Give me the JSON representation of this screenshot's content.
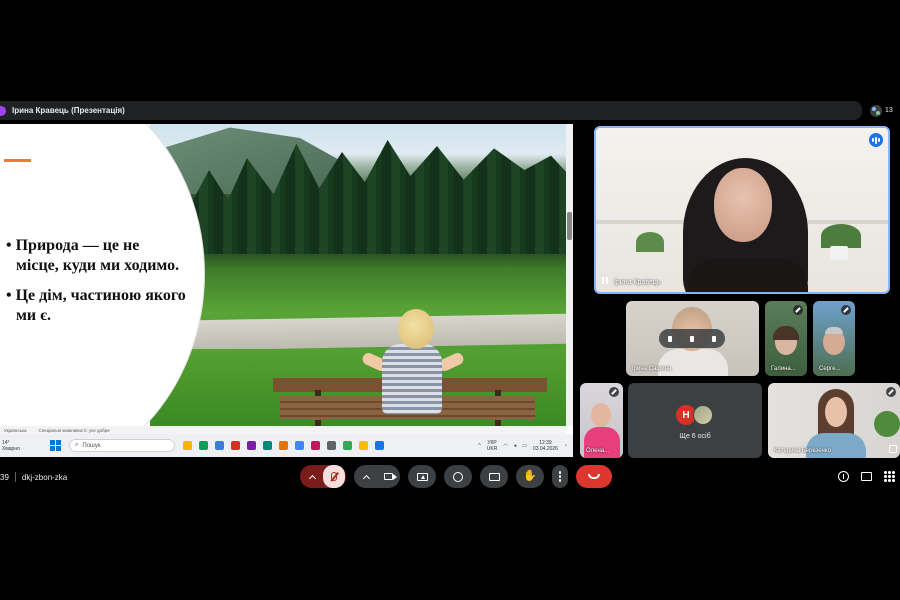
{
  "presentation": {
    "presenter_label": "Ірина Кравець (Презентація)",
    "participant_count": "13"
  },
  "slide": {
    "bullets": [
      "• Природа — це не місце, куди ми ходимо.",
      "• Це дім, частиною якого ми є."
    ]
  },
  "shared_screen": {
    "status_items": [
      "Українська",
      "Спеціальні можливості: усе добре"
    ],
    "weather": [
      "14°",
      "Хмарно"
    ],
    "search_placeholder": "Пошук",
    "tray_lang": [
      "УКР",
      "UKR"
    ],
    "clock_time": "12:39",
    "clock_date": "03.04.2026",
    "app_colors": [
      "#f4b400",
      "#0f9d58",
      "#3b7dd8",
      "#d93025",
      "#7b1fa2",
      "#00897b",
      "#e37400",
      "#4285f4",
      "#c2185b",
      "#5f6368",
      "#34a853",
      "#fbbc04",
      "#1a73e8"
    ]
  },
  "participants": {
    "main": {
      "name": "Ірина Кравець"
    },
    "tiles": [
      {
        "name": "Ірина Сашина"
      },
      {
        "name": "Галина..."
      },
      {
        "name": "Серге..."
      },
      {
        "name": "Олена..."
      },
      {
        "name": "Катерина Березенко"
      }
    ],
    "others": {
      "avatar_letter": "Н",
      "label": "Ще 6 осіб"
    }
  },
  "meeting": {
    "time": "39",
    "code": "dkj-zbon-zka"
  },
  "colors": {
    "background": "#000000",
    "bar": "#202124",
    "tile": "#3c4043",
    "speaking": "#1a73e8",
    "end_call": "#dc362e",
    "mic_muted": "#f9dedc",
    "accent": "#ee7b30"
  }
}
